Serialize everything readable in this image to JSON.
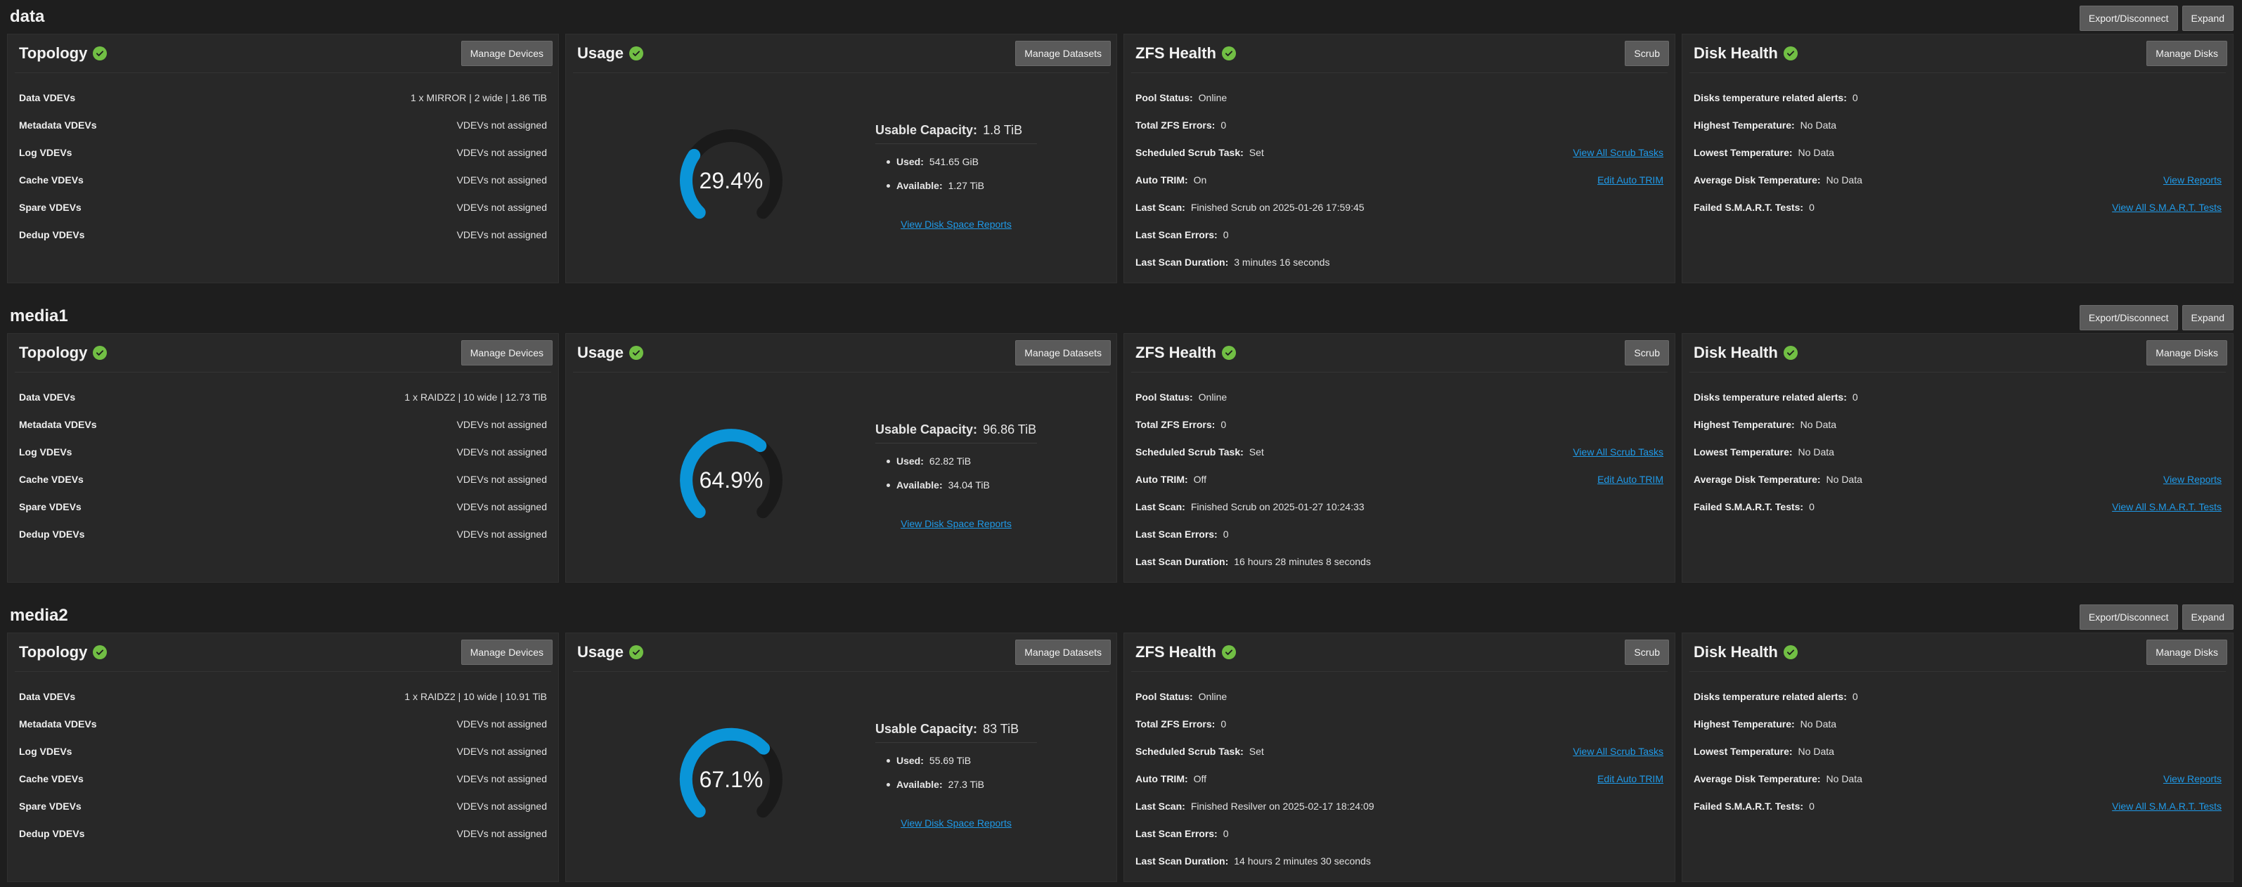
{
  "labels": {
    "export_disconnect": "Export/Disconnect",
    "expand": "Expand",
    "topology": "Topology",
    "usage": "Usage",
    "zfs_health": "ZFS Health",
    "disk_health": "Disk Health",
    "manage_devices": "Manage Devices",
    "manage_datasets": "Manage Datasets",
    "scrub": "Scrub",
    "manage_disks": "Manage Disks",
    "data_vdevs": "Data VDEVs",
    "metadata_vdevs": "Metadata VDEVs",
    "log_vdevs": "Log VDEVs",
    "cache_vdevs": "Cache VDEVs",
    "spare_vdevs": "Spare VDEVs",
    "dedup_vdevs": "Dedup VDEVs",
    "not_assigned": "VDEVs not assigned",
    "usable_capacity": "Usable Capacity:",
    "used": "Used:",
    "available": "Available:",
    "view_disk_space_reports": "View Disk Space Reports",
    "pool_status": "Pool Status:",
    "total_zfs_errors": "Total ZFS Errors:",
    "scheduled_scrub_task": "Scheduled Scrub Task:",
    "auto_trim": "Auto TRIM:",
    "last_scan": "Last Scan:",
    "last_scan_errors": "Last Scan Errors:",
    "last_scan_duration": "Last Scan Duration:",
    "view_all_scrub_tasks": "View All Scrub Tasks",
    "edit_auto_trim": "Edit Auto TRIM",
    "disk_temp_alerts": "Disks temperature related alerts:",
    "highest_temp": "Highest Temperature:",
    "lowest_temp": "Lowest Temperature:",
    "avg_disk_temp": "Average Disk Temperature:",
    "failed_smart": "Failed S.M.A.R.T. Tests:",
    "view_reports": "View Reports",
    "view_all_smart": "View All S.M.A.R.T. Tests"
  },
  "colors": {
    "gauge_fill": "#0a95d8",
    "gauge_track": "#1a1a1a",
    "ok": "#71bf44"
  },
  "pools": [
    {
      "name": "data",
      "topology": {
        "data_vdevs": "1 x MIRROR | 2 wide | 1.86 TiB"
      },
      "usage": {
        "percent_text": "29.4%",
        "percent": 29.4,
        "capacity": "1.8 TiB",
        "used": "541.65 GiB",
        "available": "1.27 TiB"
      },
      "zfs": {
        "pool_status": "Online",
        "total_errors": "0",
        "scrub_task": "Set",
        "auto_trim": "On",
        "last_scan": "Finished Scrub on 2025-01-26 17:59:45",
        "last_scan_errors": "0",
        "last_scan_duration": "3 minutes 16 seconds"
      },
      "disk": {
        "temp_alerts": "0",
        "highest": "No Data",
        "lowest": "No Data",
        "average": "No Data",
        "failed_smart": "0"
      }
    },
    {
      "name": "media1",
      "topology": {
        "data_vdevs": "1 x RAIDZ2 | 10 wide | 12.73 TiB"
      },
      "usage": {
        "percent_text": "64.9%",
        "percent": 64.9,
        "capacity": "96.86 TiB",
        "used": "62.82 TiB",
        "available": "34.04 TiB"
      },
      "zfs": {
        "pool_status": "Online",
        "total_errors": "0",
        "scrub_task": "Set",
        "auto_trim": "Off",
        "last_scan": "Finished Scrub on 2025-01-27 10:24:33",
        "last_scan_errors": "0",
        "last_scan_duration": "16 hours 28 minutes 8 seconds"
      },
      "disk": {
        "temp_alerts": "0",
        "highest": "No Data",
        "lowest": "No Data",
        "average": "No Data",
        "failed_smart": "0"
      }
    },
    {
      "name": "media2",
      "topology": {
        "data_vdevs": "1 x RAIDZ2 | 10 wide | 10.91 TiB"
      },
      "usage": {
        "percent_text": "67.1%",
        "percent": 67.1,
        "capacity": "83 TiB",
        "used": "55.69 TiB",
        "available": "27.3 TiB"
      },
      "zfs": {
        "pool_status": "Online",
        "total_errors": "0",
        "scrub_task": "Set",
        "auto_trim": "Off",
        "last_scan": "Finished Resilver on 2025-02-17 18:24:09",
        "last_scan_errors": "0",
        "last_scan_duration": "14 hours 2 minutes 30 seconds"
      },
      "disk": {
        "temp_alerts": "0",
        "highest": "No Data",
        "lowest": "No Data",
        "average": "No Data",
        "failed_smart": "0"
      }
    }
  ]
}
